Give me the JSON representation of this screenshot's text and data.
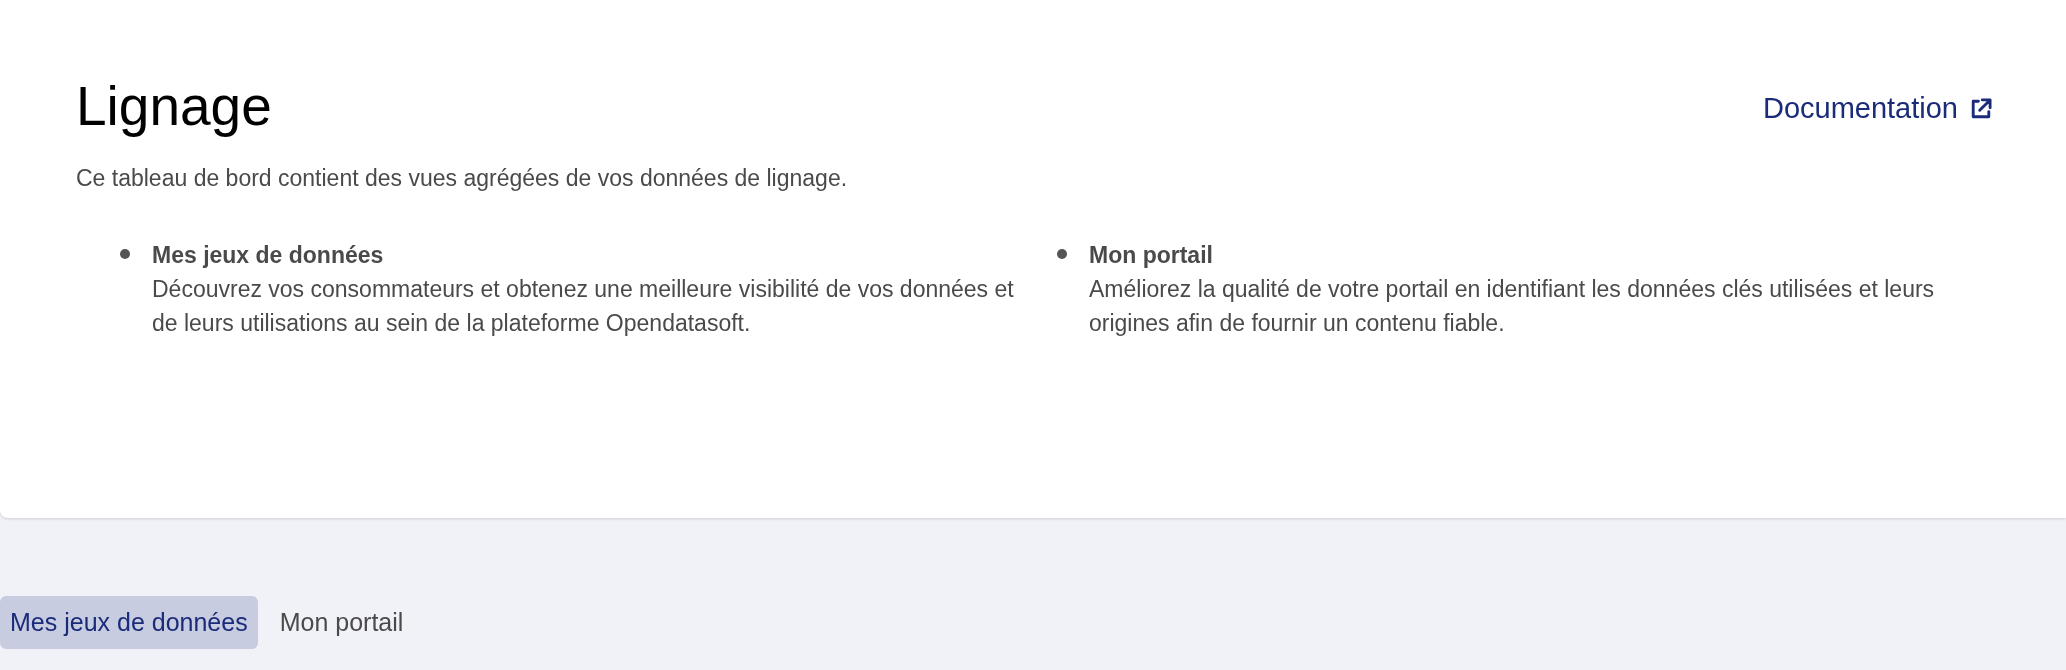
{
  "header": {
    "title": "Lignage",
    "documentation_link": "Documentation",
    "description": "Ce tableau de bord contient des vues agrégées de vos données de lignage."
  },
  "sections": [
    {
      "title": "Mes jeux de données",
      "text": "Découvrez vos consommateurs et obtenez une meilleure visibilité de vos données et de leurs utilisations au sein de la plateforme Opendatasoft."
    },
    {
      "title": "Mon portail",
      "text": "Améliorez la qualité de votre portail en identifiant les données clés utilisées et leurs origines afin de fournir un contenu fiable."
    }
  ],
  "tabs": [
    {
      "label": "Mes jeux de données",
      "selected": true
    },
    {
      "label": "Mon portail",
      "selected": false
    }
  ]
}
